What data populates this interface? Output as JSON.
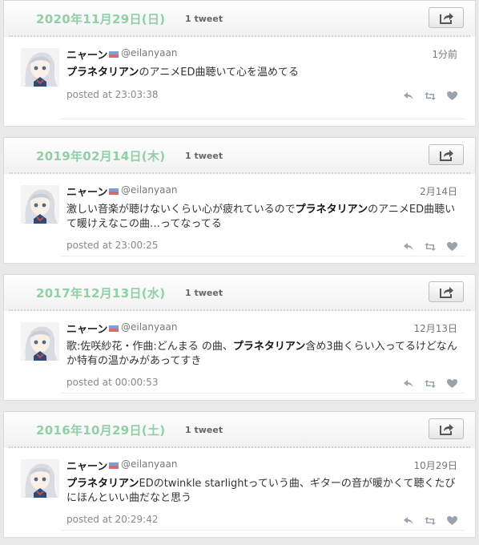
{
  "days": [
    {
      "date": "2020年11月29日(日)",
      "count": "1 tweet",
      "tweet": {
        "name": "ニャーン",
        "handle": "@eilanyaan",
        "time": "1分前",
        "text_parts": [
          {
            "t": "プラネタリアン",
            "bold": true
          },
          {
            "t": "のアニメED曲聴いて心を温めてる"
          }
        ],
        "posted": "posted at 23:03:38"
      }
    },
    {
      "date": "2019年02月14日(木)",
      "count": "1 tweet",
      "tweet": {
        "name": "ニャーン",
        "handle": "@eilanyaan",
        "time": "2月14日",
        "text_parts": [
          {
            "t": "激しい音楽が聴けないくらい心が疲れているので"
          },
          {
            "t": "プラネタリアン",
            "bold": true
          },
          {
            "t": "のアニメED曲聴いて暖けえなこの曲…ってなってる"
          }
        ],
        "posted": "posted at 23:00:25"
      }
    },
    {
      "date": "2017年12月13日(水)",
      "count": "1 tweet",
      "tweet": {
        "name": "ニャーン",
        "handle": "@eilanyaan",
        "time": "12月13日",
        "text_parts": [
          {
            "t": "歌:佐咲紗花・作曲:どんまる の曲、"
          },
          {
            "t": "プラネタリアン",
            "bold": true
          },
          {
            "t": "含め3曲くらい入ってるけどなんか特有の温かみがあってすき"
          }
        ],
        "posted": "posted at 00:00:53"
      }
    },
    {
      "date": "2016年10月29日(土)",
      "count": "1 tweet",
      "tweet": {
        "name": "ニャーン",
        "handle": "@eilanyaan",
        "time": "10月29日",
        "text_parts": [
          {
            "t": "プラネタリアン",
            "bold": true
          },
          {
            "t": "EDのtwinkle starlightっていう曲、ギターの音が暖かくて聴くたびにほんといい曲だなと思う"
          }
        ],
        "posted": "posted at 20:29:42"
      }
    }
  ],
  "icons": {
    "share": "share-icon",
    "reply": "reply-icon",
    "retweet": "retweet-icon",
    "like": "heart-icon",
    "flag": "flag-icon"
  },
  "colors": {
    "date": "#8fd0a5",
    "action_icon": "#9aa3ad"
  }
}
